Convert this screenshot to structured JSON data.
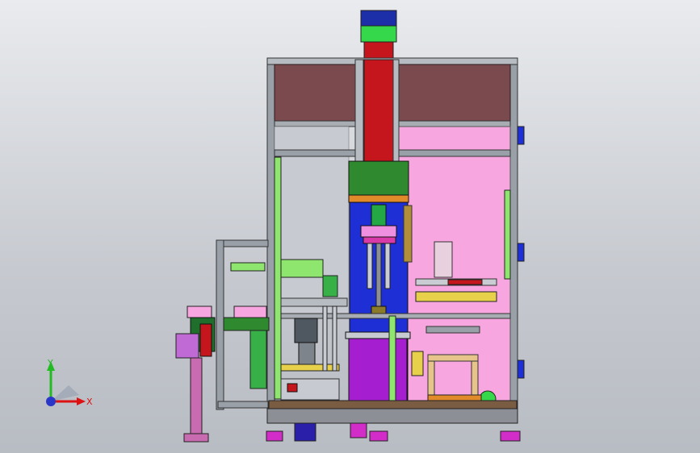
{
  "viewport": {
    "background": "#c9ccd1"
  },
  "triad": {
    "x_label": "X",
    "y_label": "Y"
  },
  "colors": {
    "frame": "#7a7f86",
    "top_panel": "#7b4a4e",
    "column": "#c4161c",
    "motor_top": "#1d2fa8",
    "motor_green": "#35d84a",
    "pink_panel": "#f8a6df",
    "blue_panel": "#1f2fd6",
    "purple": "#a51fd0",
    "green_block": "#2f8a2f",
    "yellow": "#e7d04a",
    "orange": "#e08a2a",
    "light_green": "#8ee66e",
    "base_gray": "#8c9096",
    "magenta_feet": "#d22dc8"
  }
}
